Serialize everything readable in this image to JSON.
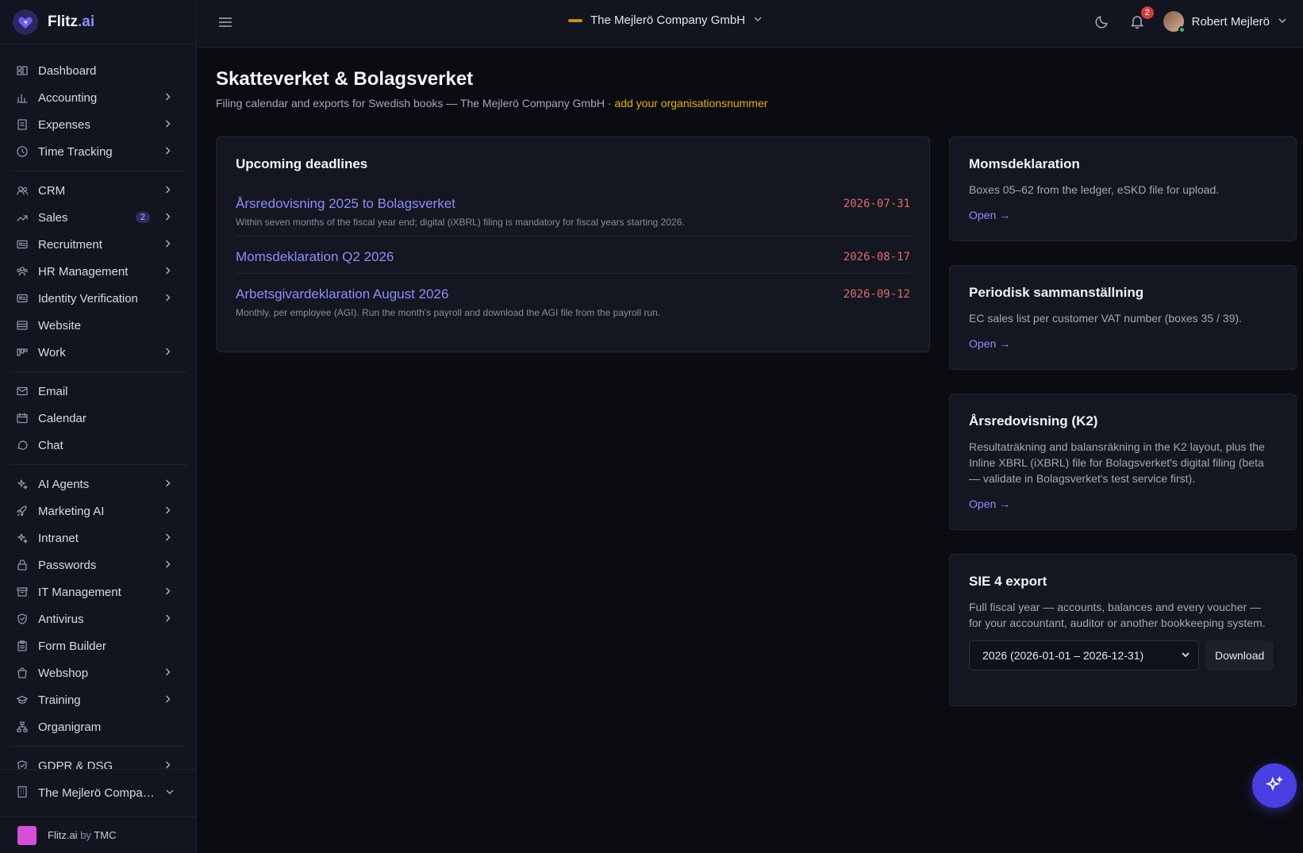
{
  "brand": {
    "name": "Flitz",
    "suffix": ".ai"
  },
  "sidebar": {
    "items": [
      {
        "label": "Dashboard",
        "icon": "dashboard-icon",
        "chevron": false
      },
      {
        "label": "Accounting",
        "icon": "chart-icon",
        "chevron": true
      },
      {
        "label": "Expenses",
        "icon": "receipt-icon",
        "chevron": true
      },
      {
        "label": "Time Tracking",
        "icon": "clock-icon",
        "chevron": true
      },
      {
        "label": "CRM",
        "icon": "users-icon",
        "chevron": true
      },
      {
        "label": "Sales",
        "icon": "trend-icon",
        "chevron": true,
        "badge": "2"
      },
      {
        "label": "Recruitment",
        "icon": "id-card-icon",
        "chevron": true
      },
      {
        "label": "HR Management",
        "icon": "people-icon",
        "chevron": true
      },
      {
        "label": "Identity Verification",
        "icon": "id-card-icon",
        "chevron": true
      },
      {
        "label": "Website",
        "icon": "layout-icon",
        "chevron": false
      },
      {
        "label": "Work",
        "icon": "kanban-icon",
        "chevron": true
      },
      {
        "label": "Email",
        "icon": "mail-icon",
        "chevron": false
      },
      {
        "label": "Calendar",
        "icon": "calendar-icon",
        "chevron": false
      },
      {
        "label": "Chat",
        "icon": "chat-icon",
        "chevron": false
      },
      {
        "label": "AI Agents",
        "icon": "sparkle-icon",
        "chevron": true
      },
      {
        "label": "Marketing AI",
        "icon": "rocket-icon",
        "chevron": true
      },
      {
        "label": "Intranet",
        "icon": "sparkle-icon",
        "chevron": true
      },
      {
        "label": "Passwords",
        "icon": "lock-icon",
        "chevron": true
      },
      {
        "label": "IT Management",
        "icon": "archive-icon",
        "chevron": true
      },
      {
        "label": "Antivirus",
        "icon": "shield-icon",
        "chevron": true
      },
      {
        "label": "Form Builder",
        "icon": "clipboard-icon",
        "chevron": false
      },
      {
        "label": "Webshop",
        "icon": "bag-icon",
        "chevron": true
      },
      {
        "label": "Training",
        "icon": "graduation-icon",
        "chevron": true
      },
      {
        "label": "Organigram",
        "icon": "org-icon",
        "chevron": false
      },
      {
        "label": "GDPR & DSG",
        "icon": "shield-icon",
        "chevron": true
      }
    ],
    "company_switch": "The Mejlerö Compan...",
    "footer": {
      "brand": "Flitz.ai",
      "by": "by",
      "org": "TMC"
    }
  },
  "topbar": {
    "company": "The Mejlerö Company GmbH",
    "notification_count": "2",
    "user_name": "Robert Mejlerö"
  },
  "page": {
    "title": "Skatteverket & Bolagsverket",
    "subtitle": "Filing calendar and exports for Swedish books — The Mejlerö Company GmbH · ",
    "subtitle_link": "add your organisationsnummer"
  },
  "deadlines": {
    "title": "Upcoming deadlines",
    "items": [
      {
        "title": "Årsredovisning 2025 to Bolagsverket",
        "date": "2026-07-31",
        "desc": "Within seven months of the fiscal year end; digital (iXBRL) filing is mandatory for fiscal years starting 2026."
      },
      {
        "title": "Momsdeklaration Q2 2026",
        "date": "2026-08-17",
        "desc": ""
      },
      {
        "title": "Arbetsgivardeklaration August 2026",
        "date": "2026-09-12",
        "desc": "Monthly, per employee (AGI). Run the month's payroll and download the AGI file from the payroll run."
      }
    ]
  },
  "cards": {
    "moms": {
      "title": "Momsdeklaration",
      "desc": "Boxes 05–62 from the ledger, eSKD file for upload.",
      "link": "Open →"
    },
    "periodisk": {
      "title": "Periodisk sammanställning",
      "desc": "EC sales list per customer VAT number (boxes 35 / 39).",
      "link": "Open →"
    },
    "arsredovisning": {
      "title": "Årsredovisning (K2)",
      "desc": "Resultaträkning and balansräkning in the K2 layout, plus the Inline XBRL (iXBRL) file for Bolagsverket's digital filing (beta — validate in Bolagsverket's test service first).",
      "link": "Open →"
    },
    "sie": {
      "title": "SIE 4 export",
      "desc": "Full fiscal year — accounts, balances and every voucher — for your accountant, auditor or another bookkeeping system.",
      "select_value": "2026 (2026-01-01 – 2026-12-31)",
      "button": "Download"
    }
  },
  "colors": {
    "accent": "#8c8ff7",
    "date": "#e06b6b",
    "warning_link": "#e2b100",
    "fab": "#4a3fe0"
  }
}
